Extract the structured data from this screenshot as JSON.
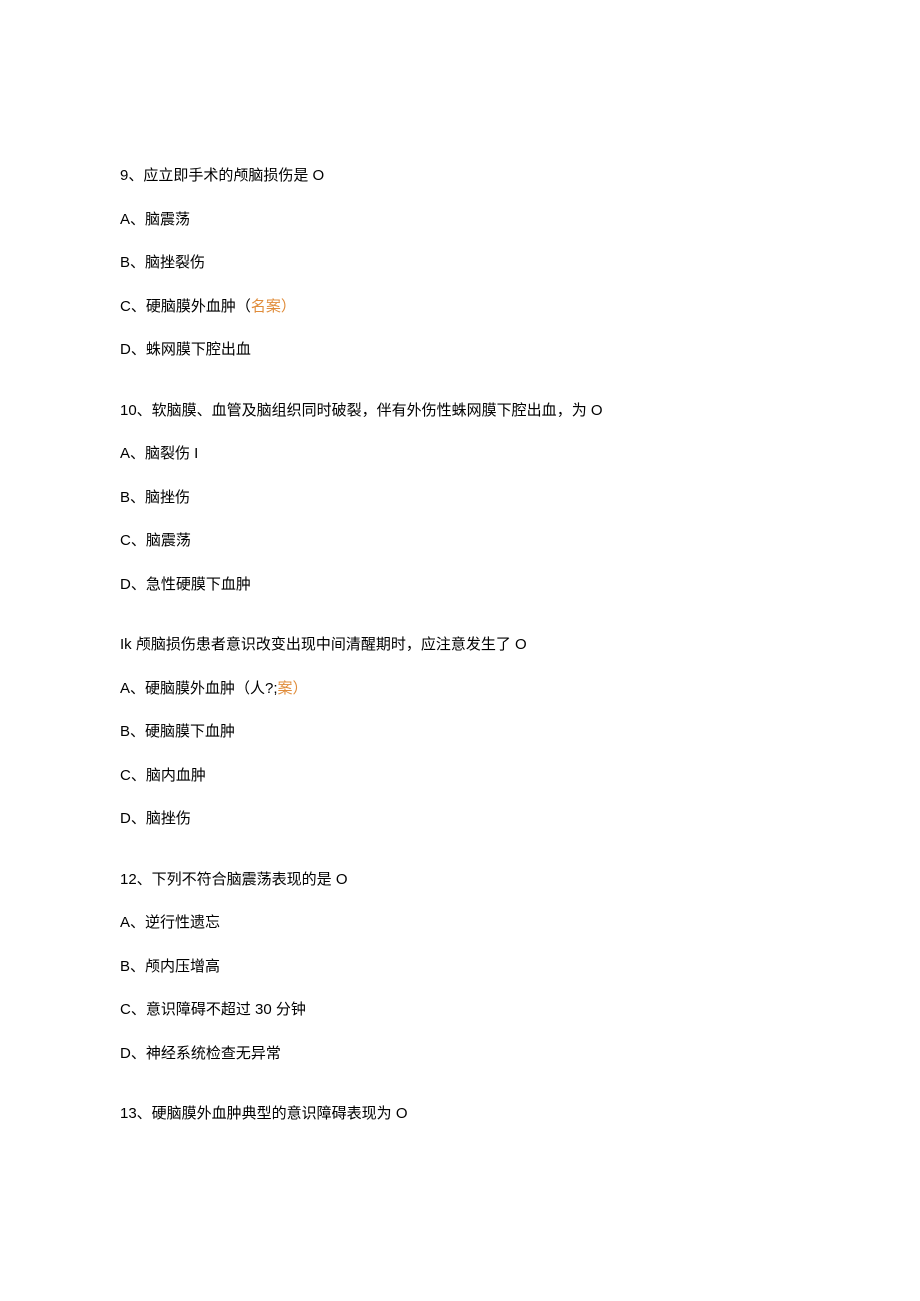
{
  "questions": [
    {
      "stem": "9、应立即手术的颅脑损伤是 O",
      "options": [
        {
          "prefix": "A、脑震荡",
          "answer": ""
        },
        {
          "prefix": "B、脑挫裂伤",
          "answer": ""
        },
        {
          "prefix": "C、硬脑膜外血肿（",
          "answer": "名案）"
        },
        {
          "prefix": "D、蛛网膜下腔出血",
          "answer": ""
        }
      ]
    },
    {
      "stem": "10、软脑膜、血管及脑组织同时破裂，伴有外伤性蛛网膜下腔出血，为 O",
      "options": [
        {
          "prefix": "A、脑裂伤 I",
          "answer": ""
        },
        {
          "prefix": "B、脑挫伤",
          "answer": ""
        },
        {
          "prefix": "C、脑震荡",
          "answer": ""
        },
        {
          "prefix": "D、急性硬膜下血肿",
          "answer": ""
        }
      ]
    },
    {
      "stem": "Ik 颅脑损伤患者意识改变出现中间清醒期时，应注意发生了 O",
      "options": [
        {
          "prefix": "A、硬脑膜外血肿（人?;",
          "answer": "案）"
        },
        {
          "prefix": "B、硬脑膜下血肿",
          "answer": ""
        },
        {
          "prefix": "C、脑内血肿",
          "answer": ""
        },
        {
          "prefix": "D、脑挫伤",
          "answer": ""
        }
      ]
    },
    {
      "stem": "12、下列不符合脑震荡表现的是 O",
      "options": [
        {
          "prefix": "A、逆行性遗忘",
          "answer": ""
        },
        {
          "prefix": "B、颅内压增高",
          "answer": ""
        },
        {
          "prefix": "C、意识障碍不超过 30 分钟",
          "answer": ""
        },
        {
          "prefix": "D、神经系统检查无异常",
          "answer": ""
        }
      ]
    },
    {
      "stem": "13、硬脑膜外血肿典型的意识障碍表现为 O",
      "options": []
    }
  ]
}
